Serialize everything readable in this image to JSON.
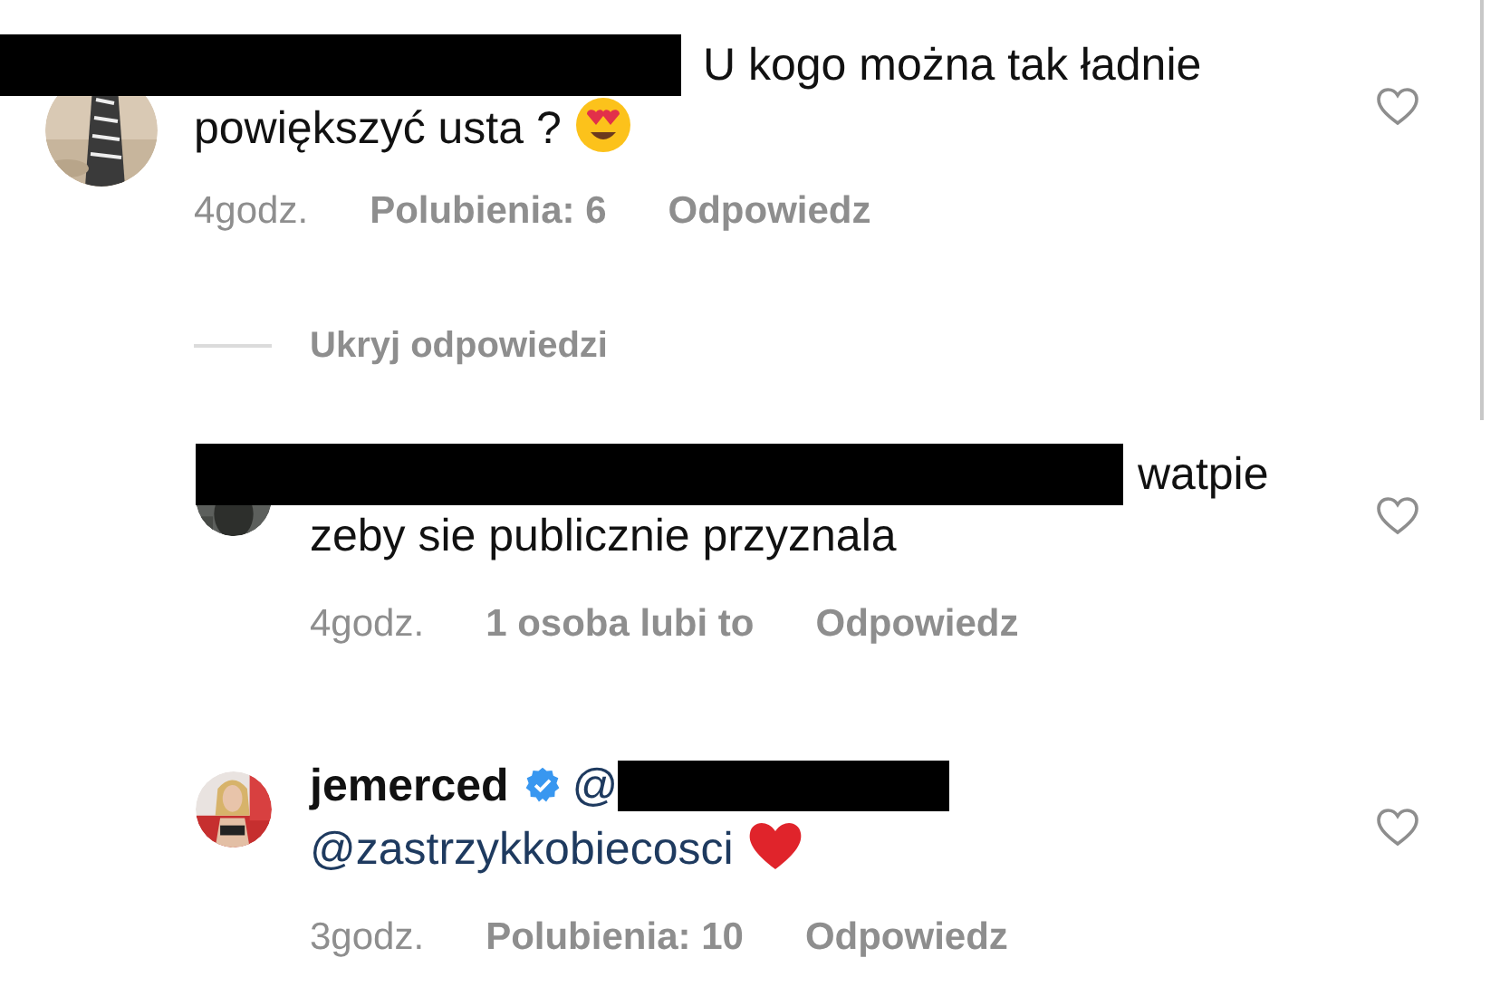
{
  "comments": [
    {
      "redacted_prefix": true,
      "text_lines": [
        "U kogo można tak ładnie",
        "powiększyć usta ?"
      ],
      "emoji": {
        "kind": "heart-eyes"
      },
      "time": "4godz.",
      "likes": "Polubienia: 6",
      "reply": "Odpowiedz",
      "liked": false,
      "replies_toggle": "Ukryj odpowiedzi",
      "replies": [
        {
          "redacted_prefix": true,
          "text_lines": [
            "watpie",
            "zeby sie publicznie przyznala"
          ],
          "time": "4godz.",
          "likes": "1 osoba lubi to",
          "reply": "Odpowiedz",
          "liked": false
        },
        {
          "username": "jemerced",
          "verified": true,
          "mention_prefix": "@",
          "redacted_mention": true,
          "mention": "@zastrzykkobiecosci",
          "emoji": {
            "kind": "red-heart"
          },
          "time": "3godz.",
          "likes": "Polubienia: 10",
          "reply": "Odpowiedz",
          "liked": false
        }
      ]
    }
  ]
}
